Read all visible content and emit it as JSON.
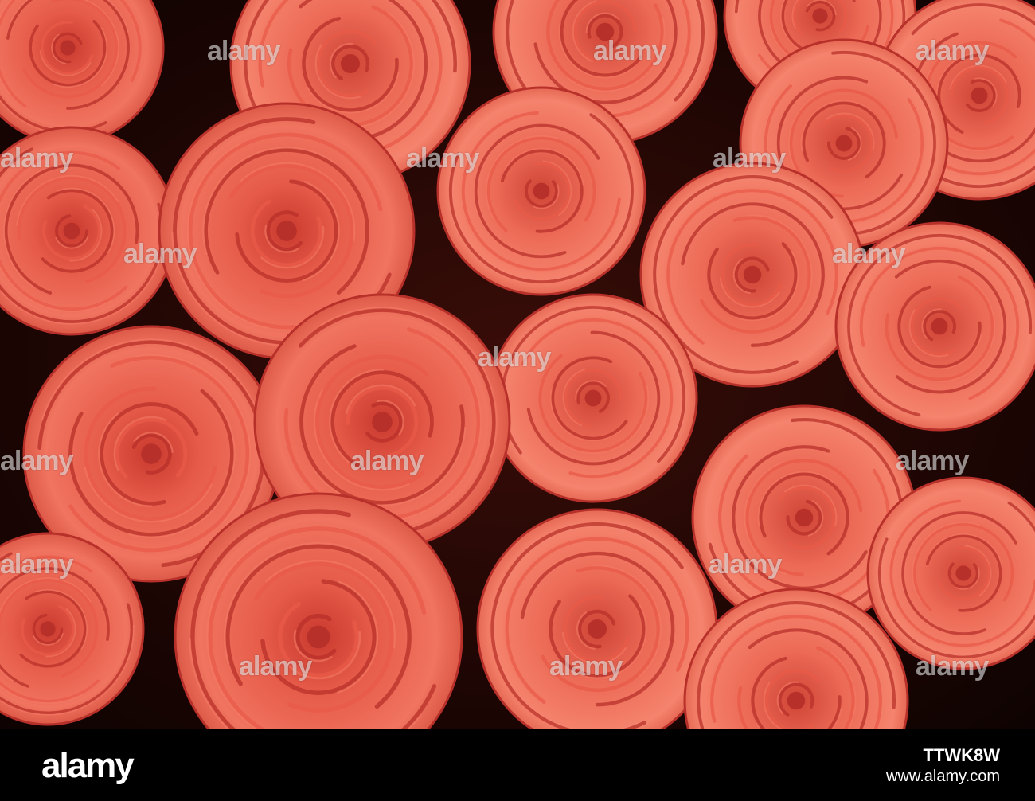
{
  "image": {
    "subject": "roses",
    "colors": {
      "petal_light": "#f37a64",
      "petal_mid": "#e85a48",
      "petal_dark": "#b8302a",
      "background": "#1a0503"
    }
  },
  "watermark": {
    "text": "alamy"
  },
  "footer": {
    "logo": "alamy",
    "image_id": "TTWK8W",
    "site": "www.alamy.com"
  }
}
